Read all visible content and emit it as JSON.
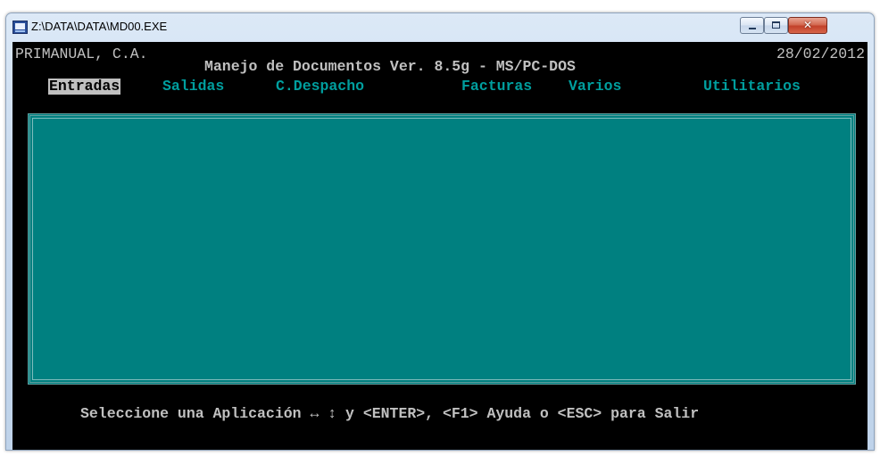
{
  "window": {
    "title": "Z:\\DATA\\DATA\\MD00.EXE",
    "icon": "dos-app-icon",
    "controls": {
      "minimize": "minimize-icon",
      "maximize": "maximize-icon",
      "close_label": "✕"
    }
  },
  "console": {
    "company": "PRIMANUAL, C.A.",
    "date": "28/02/2012",
    "app_title": "Manejo de Documentos Ver. 8.5g - MS/PC-DOS",
    "menu": {
      "items": [
        {
          "label": "Entradas",
          "selected": true
        },
        {
          "label": "Salidas",
          "selected": false
        },
        {
          "label": "C.Despacho",
          "selected": false
        },
        {
          "label": "Facturas",
          "selected": false
        },
        {
          "label": "Varios",
          "selected": false
        },
        {
          "label": "Utilitarios",
          "selected": false
        }
      ]
    },
    "status_line": "Seleccione una Aplicación ↔ ↕ y <ENTER>, <F1> Ayuda o <ESC> para Salir"
  },
  "colors": {
    "console_bg": "#000000",
    "panel_bg": "#008080",
    "menu_text": "#009e9e",
    "menu_selected_bg": "#c0c0c0",
    "text": "#c0c0c0"
  }
}
